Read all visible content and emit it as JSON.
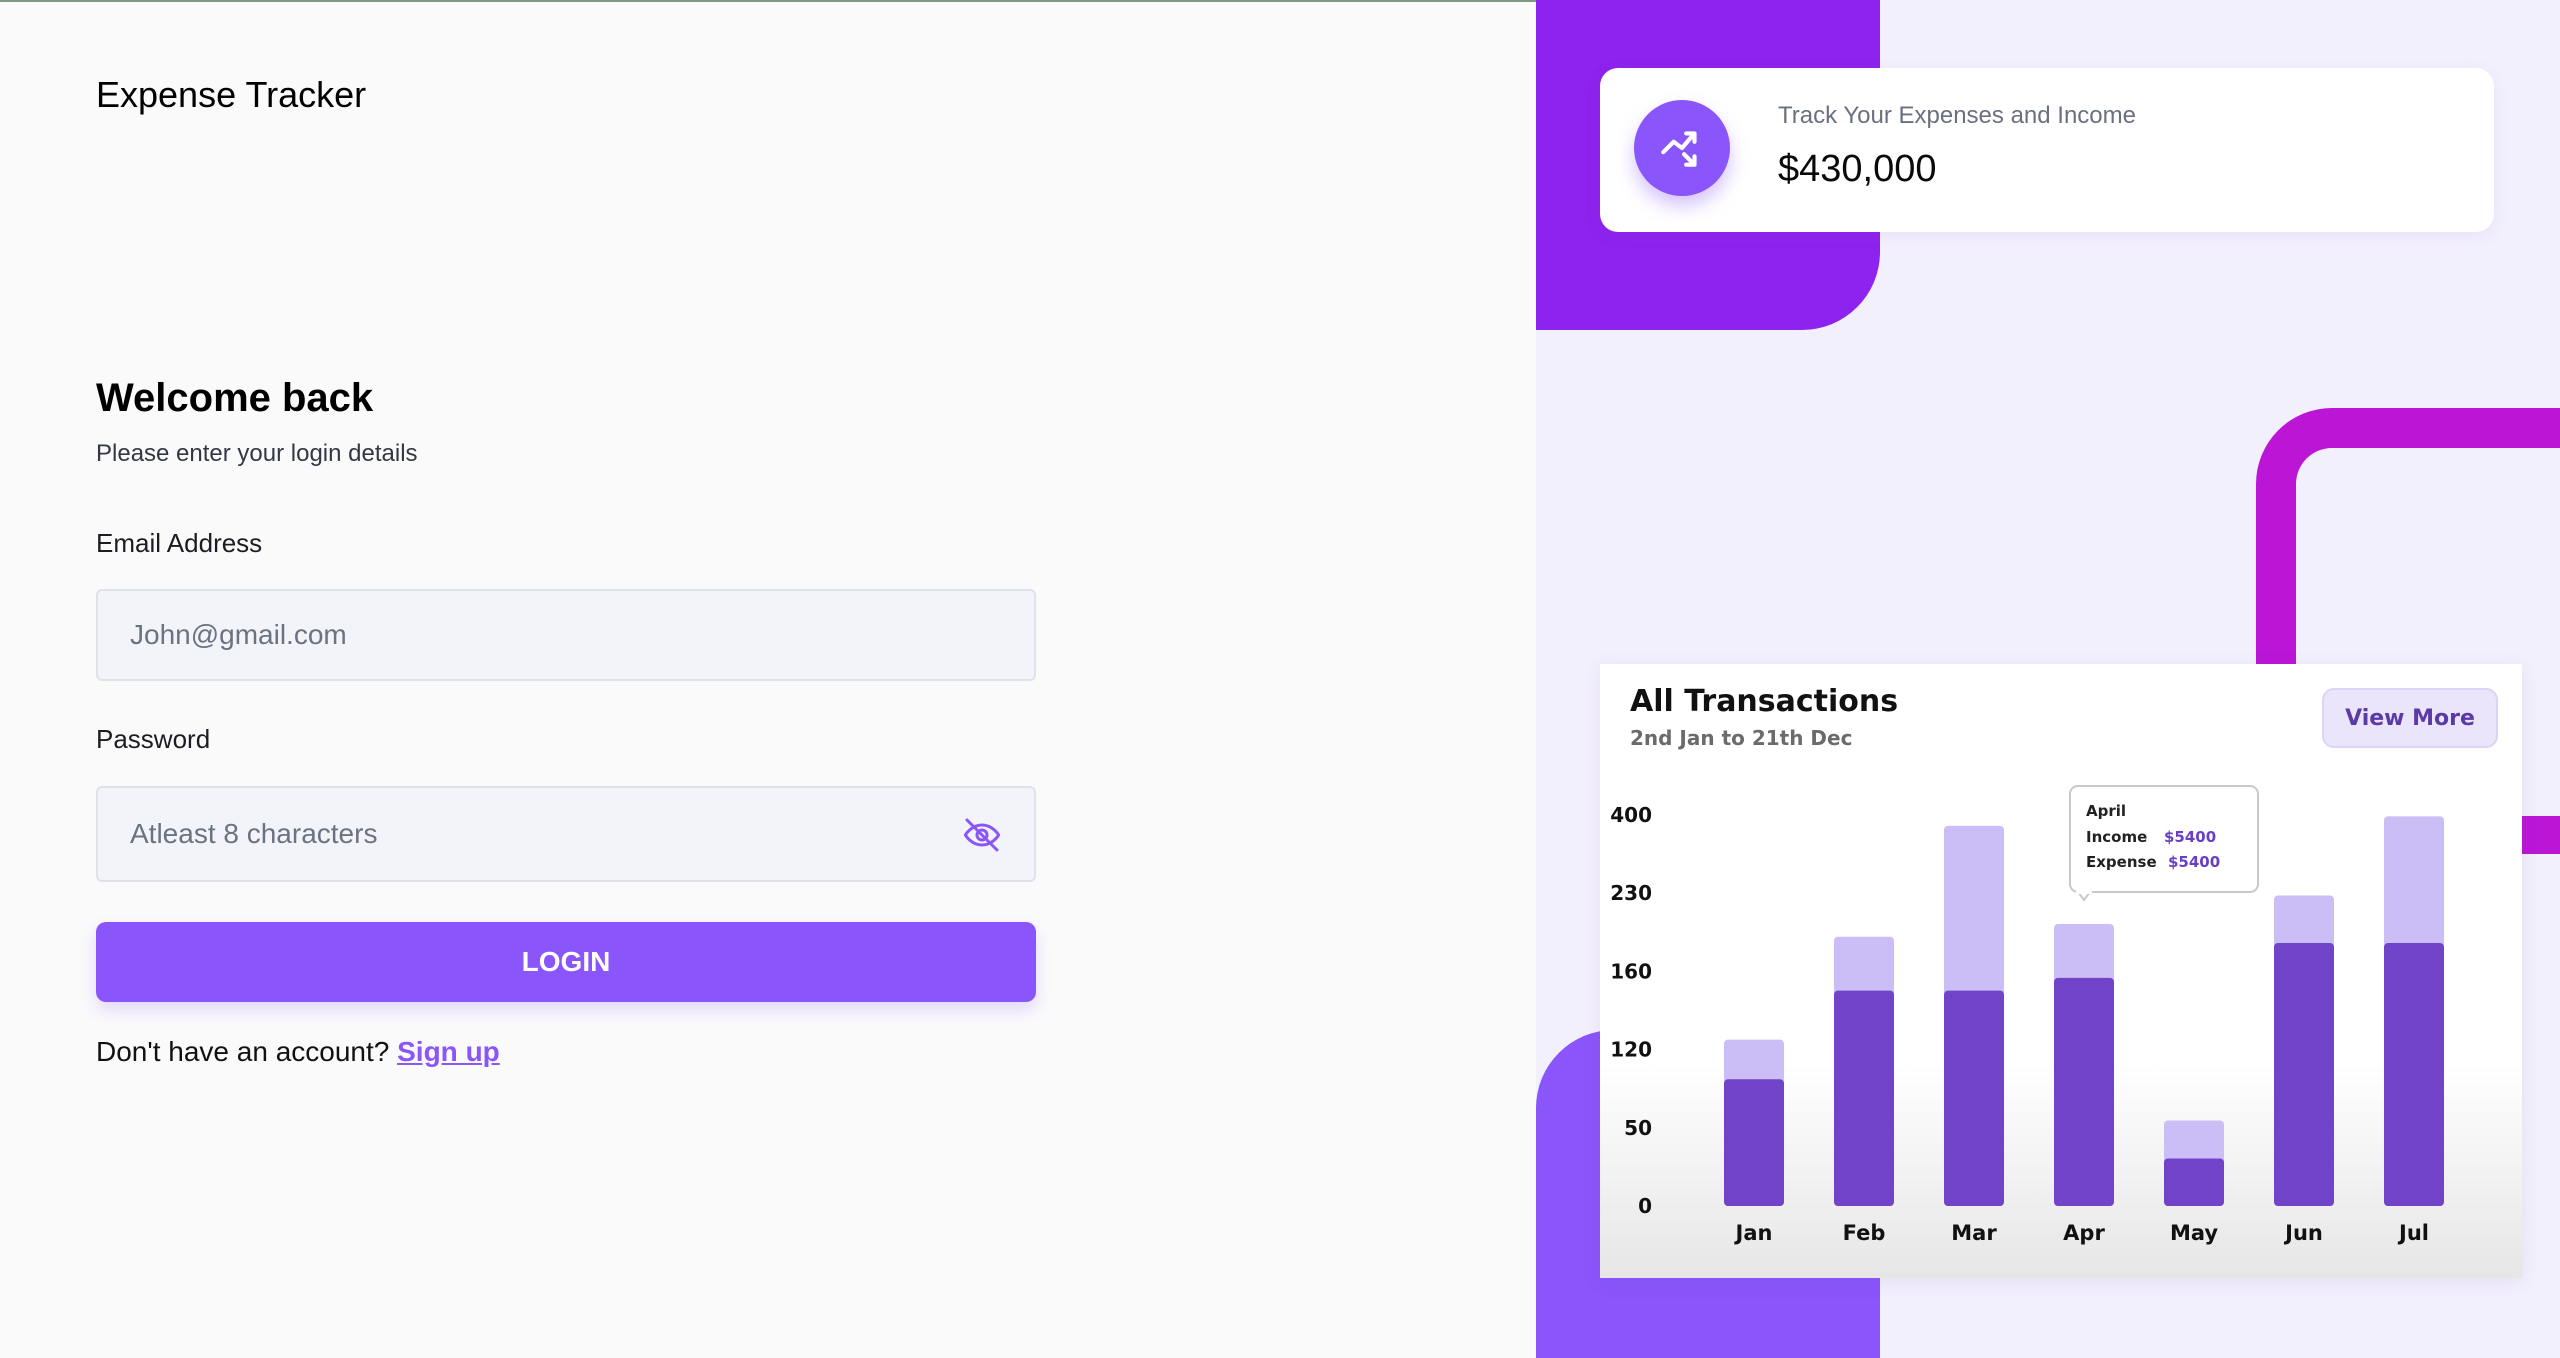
{
  "app": {
    "title": "Expense Tracker"
  },
  "login": {
    "heading": "Welcome back",
    "subheading": "Please enter your login details",
    "email_label": "Email Address",
    "email_placeholder": "John@gmail.com",
    "email_value": "",
    "password_label": "Password",
    "password_placeholder": "Atleast 8 characters",
    "password_value": "",
    "password_toggle_icon": "eye-off-icon",
    "login_button": "LOGIN",
    "signup_prompt": "Don't have an account?",
    "signup_link": "Sign up"
  },
  "stat_card": {
    "icon": "trending-up-icon",
    "label": "Track Your Expenses and Income",
    "value": "$430,000"
  },
  "transactions": {
    "title": "All Transactions",
    "subtitle": "2nd Jan to 21th Dec",
    "view_more": "View More",
    "tooltip": {
      "month": "April",
      "income_label": "Income",
      "income_value": "$5400",
      "expense_label": "Expense",
      "expense_value": "$5400"
    }
  },
  "colors": {
    "accent": "#8a55fb",
    "bar_dark": "#7043c8",
    "bar_light": "#cbbdf5",
    "panel_purple": "#8e22ee",
    "magenta": "#bb16d6"
  },
  "chart_data": {
    "type": "bar",
    "categories": [
      "Jan",
      "Feb",
      "Mar",
      "Apr",
      "May",
      "Jun",
      "Jul"
    ],
    "y_ticks": [
      "400",
      "230",
      "160",
      "120",
      "50",
      "0"
    ],
    "series": [
      {
        "values": [
          80,
          136,
          136,
          144,
          30,
          166,
          166
        ]
      },
      {
        "values": [
          105,
          170,
          240,
          178,
          54,
          196,
          246
        ]
      }
    ],
    "stacked": false,
    "ylim": [
      0,
      250
    ]
  }
}
